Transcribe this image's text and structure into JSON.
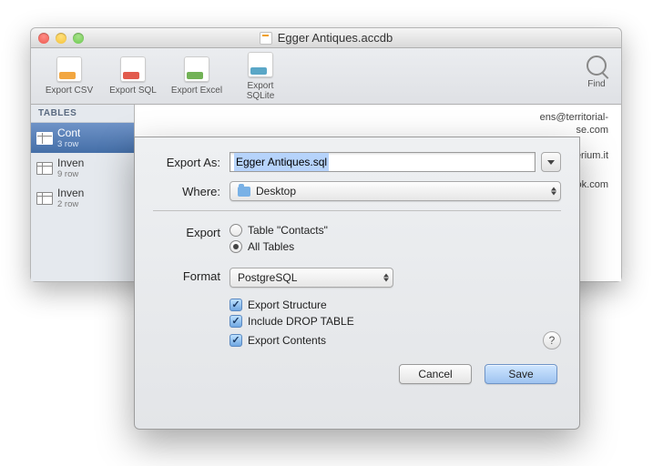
{
  "window": {
    "title": "Egger Antiques.accdb"
  },
  "toolbar": {
    "export_csv": "Export CSV",
    "export_sql": "Export SQL",
    "export_excel": "Export Excel",
    "export_sqlite": "Export SQLite",
    "find": "Find"
  },
  "sidebar": {
    "header": "TABLES",
    "items": [
      {
        "name": "Cont",
        "sub": "3 row"
      },
      {
        "name": "Inven",
        "sub": "9 row"
      },
      {
        "name": "Inven",
        "sub": "2 row"
      }
    ]
  },
  "content": {
    "emails": [
      "ens@territorial-",
      "se.com",
      "@imperium.it",
      "acebook.com"
    ]
  },
  "dialog": {
    "export_as_label": "Export As:",
    "export_as_value": "Egger Antiques.sql",
    "where_label": "Where:",
    "where_value": "Desktop",
    "export_label": "Export",
    "radio_table": "Table \"Contacts\"",
    "radio_all": "All Tables",
    "format_label": "Format",
    "format_value": "PostgreSQL",
    "cb_structure": "Export Structure",
    "cb_drop": "Include DROP TABLE",
    "cb_contents": "Export Contents",
    "cancel": "Cancel",
    "save": "Save"
  }
}
